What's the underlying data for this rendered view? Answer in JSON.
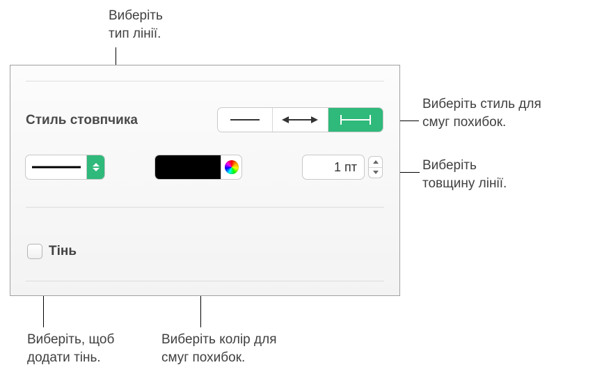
{
  "callouts": {
    "line_type": "Виберіть\nтип лінії.",
    "error_style": "Виберіть стиль для\nсмуг похибок.",
    "line_width": "Виберіть\nтовщину лінії.",
    "shadow_add": "Виберіть, щоб\nдодати тінь.",
    "color": "Виберіть колір для\nсмуг похибок."
  },
  "panel": {
    "section_label": "Стиль стовпчика",
    "shadow_label": "Тінь",
    "line_width_value": "1 пт",
    "line_color": "#000000"
  }
}
